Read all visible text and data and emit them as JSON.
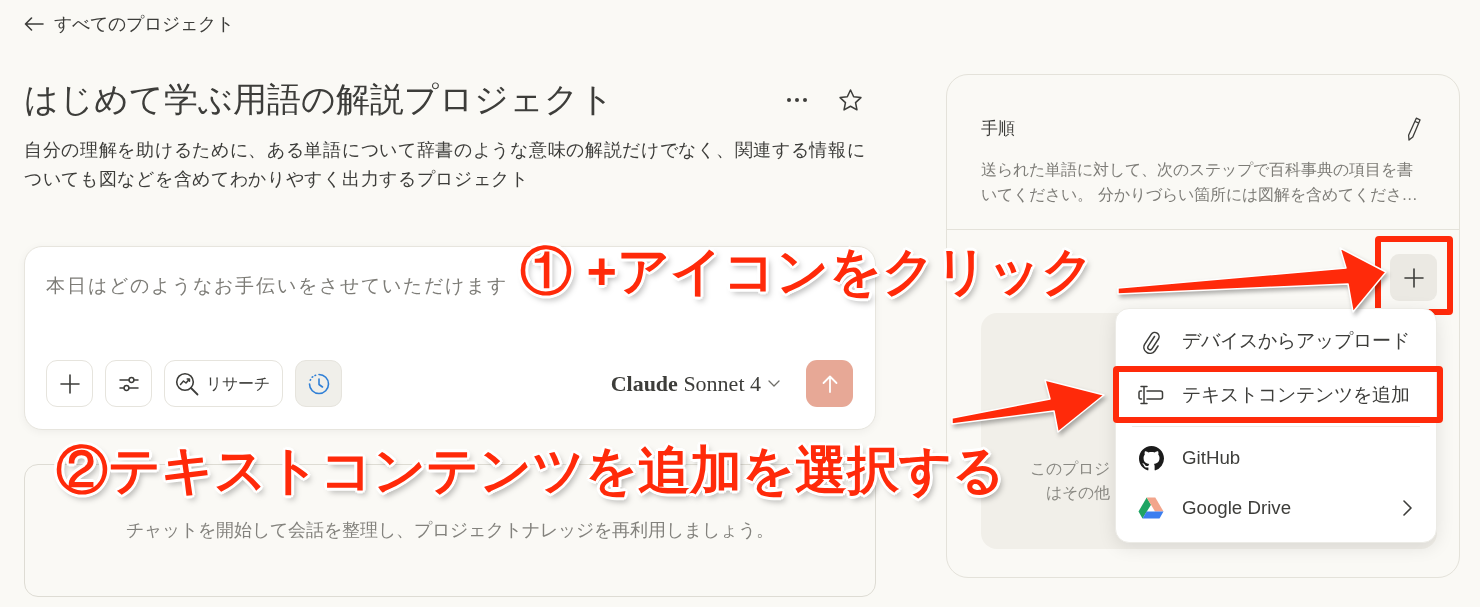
{
  "back_link": {
    "label": "すべてのプロジェクト"
  },
  "project": {
    "title": "はじめて学ぶ用語の解説プロジェクト",
    "starred": false,
    "description": "自分の理解を助けるために、ある単語について辞書のような意味の解説だけでなく、関連する情報についても図などを含めてわかりやすく出力するプロジェクト"
  },
  "composer": {
    "placeholder": "本日はどのようなお手伝いをさせていただけます",
    "tools": [
      {
        "kind": "add",
        "on": false
      },
      {
        "kind": "options",
        "on": false
      },
      {
        "kind": "research",
        "label": "リサーチ",
        "on": false
      },
      {
        "kind": "thinking",
        "on": true
      }
    ],
    "model": "**Claude** Sonnet 4",
    "send": {
      "disabled": true
    }
  },
  "chats": {
    "empty_text": "チャットを開始して会話を整理し、プロジェクトナレッジを再利用しましょう。"
  },
  "instructions": {
    "title": "手順",
    "lines": [
      "送られた単語に対して、次のステップで百科事典の項目を書",
      "いてください。 分かりづらい箇所には図解を含めてくださ…"
    ]
  },
  "files": {
    "add_button": {
      "highlighted": true
    },
    "empty_lines": [
      "このプロジ",
      "はその他"
    ],
    "menu": [
      {
        "kind": "upload",
        "label": "デバイスからアップロード",
        "highlighted": false,
        "submenu": false
      },
      {
        "kind": "text",
        "label": "テキストコンテンツを追加",
        "highlighted": true,
        "submenu": false
      },
      {
        "kind": "github",
        "label": "GitHub",
        "highlighted": false,
        "submenu": false
      },
      {
        "kind": "google_drive",
        "label": "Google Drive",
        "highlighted": false,
        "submenu": true
      }
    ]
  },
  "annotations": [
    {
      "kind": "callout",
      "text": "① +アイコンをクリック"
    },
    {
      "kind": "callout",
      "text": "②テキストコンテンツを追加を選択する"
    }
  ]
}
